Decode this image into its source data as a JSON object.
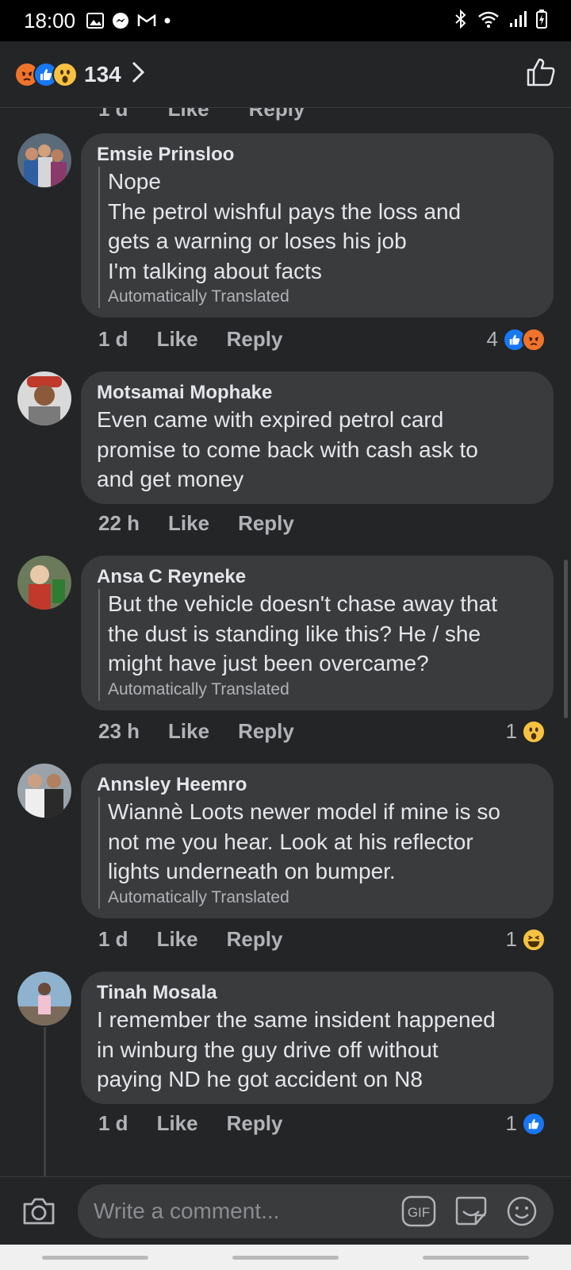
{
  "status_bar": {
    "time": "18:00"
  },
  "header": {
    "reaction_count": "134"
  },
  "previous_comment_actions": {
    "time": "1 d",
    "like": "Like",
    "reply": "Reply"
  },
  "comments": [
    {
      "author": "Emsie Prinsloo",
      "lines": [
        "Nope",
        "The petrol wishful pays the loss and",
        "gets a warning or loses his job",
        "I'm talking about facts"
      ],
      "translated_note": "Automatically Translated",
      "time": "1 d",
      "like": "Like",
      "reply": "Reply",
      "reaction_count": "4",
      "reactions": [
        "like",
        "angry"
      ]
    },
    {
      "author": "Motsamai Mophake",
      "lines": [
        "Even came with expired petrol card",
        "promise to come back with cash ask to",
        "and get money"
      ],
      "time": "22 h",
      "like": "Like",
      "reply": "Reply"
    },
    {
      "author": "Ansa C Reyneke",
      "lines": [
        "But the vehicle doesn't chase away that",
        "the dust is standing like this? He / she",
        "might have just been overcame?"
      ],
      "translated_note": "Automatically Translated",
      "time": "23 h",
      "like": "Like",
      "reply": "Reply",
      "reaction_count": "1",
      "reactions": [
        "wow"
      ]
    },
    {
      "author": "Annsley Heemro",
      "lines": [
        "Wiannè Loots newer model if mine is so",
        "not me you hear. Look at his reflector",
        "lights underneath on bumper."
      ],
      "translated_note": "Automatically Translated",
      "time": "1 d",
      "like": "Like",
      "reply": "Reply",
      "reaction_count": "1",
      "reactions": [
        "haha"
      ]
    },
    {
      "author": "Tinah Mosala",
      "lines": [
        "I remember the same insident happened",
        "in winburg the guy drive off without",
        "paying ND he got accident on N8"
      ],
      "time": "1 d",
      "like": "Like",
      "reply": "Reply",
      "reaction_count": "1",
      "reactions": [
        "like"
      ]
    }
  ],
  "composer": {
    "placeholder": "Write a comment...",
    "gif_label": "GIF"
  },
  "colors": {
    "like_blue": "#1877f2",
    "angry_orange": "#f0732c",
    "wow_yellow": "#f7c243",
    "bubble": "#3a3b3c",
    "background": "#242526"
  }
}
